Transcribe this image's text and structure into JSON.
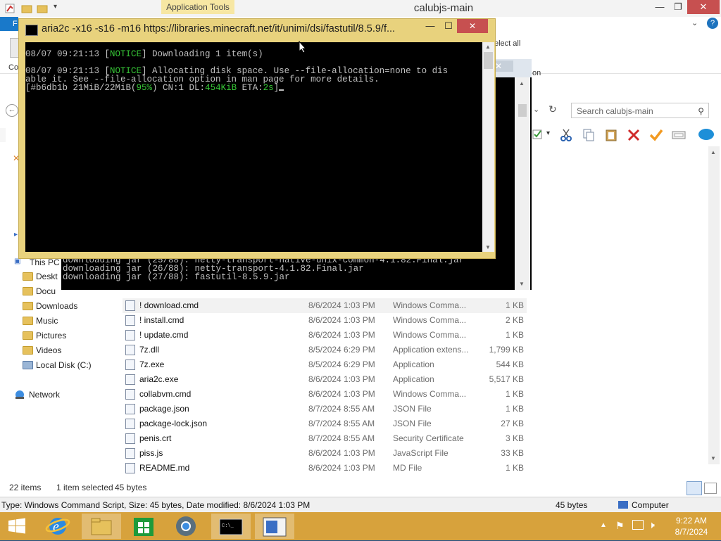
{
  "explorer": {
    "title": "calubjs-main",
    "context_tab": "Application Tools",
    "ribbon": {
      "select_all": "elect all",
      "cut_label": "Co",
      "open_label": "on"
    },
    "search_placeholder": "Search calubjs-main",
    "nav": {
      "this_pc": "This PC",
      "items": [
        {
          "label": "Deskt"
        },
        {
          "label": "Docu"
        },
        {
          "label": "Downloads"
        },
        {
          "label": "Music"
        },
        {
          "label": "Pictures"
        },
        {
          "label": "Videos"
        },
        {
          "label": "Local Disk (C:)"
        }
      ],
      "network": "Network"
    },
    "files": [
      {
        "name": "! download.cmd",
        "date": "8/6/2024 1:03 PM",
        "type": "Windows Comma...",
        "size": "1 KB",
        "selected": true
      },
      {
        "name": "! install.cmd",
        "date": "8/6/2024 1:03 PM",
        "type": "Windows Comma...",
        "size": "2 KB"
      },
      {
        "name": "! update.cmd",
        "date": "8/6/2024 1:03 PM",
        "type": "Windows Comma...",
        "size": "1 KB"
      },
      {
        "name": "7z.dll",
        "date": "8/5/2024 6:29 PM",
        "type": "Application extens...",
        "size": "1,799 KB"
      },
      {
        "name": "7z.exe",
        "date": "8/5/2024 6:29 PM",
        "type": "Application",
        "size": "544 KB"
      },
      {
        "name": "aria2c.exe",
        "date": "8/6/2024 1:03 PM",
        "type": "Application",
        "size": "5,517 KB"
      },
      {
        "name": "collabvm.cmd",
        "date": "8/6/2024 1:03 PM",
        "type": "Windows Comma...",
        "size": "1 KB"
      },
      {
        "name": "package.json",
        "date": "8/7/2024 8:55 AM",
        "type": "JSON File",
        "size": "1 KB"
      },
      {
        "name": "package-lock.json",
        "date": "8/7/2024 8:55 AM",
        "type": "JSON File",
        "size": "27 KB"
      },
      {
        "name": "penis.crt",
        "date": "8/7/2024 8:55 AM",
        "type": "Security Certificate",
        "size": "3 KB"
      },
      {
        "name": "piss.js",
        "date": "8/6/2024 1:03 PM",
        "type": "JavaScript File",
        "size": "33 KB"
      },
      {
        "name": "README.md",
        "date": "8/6/2024 1:03 PM",
        "type": "MD File",
        "size": "1 KB"
      }
    ],
    "status": {
      "items": "22 items",
      "selected": "1 item selected",
      "sel_size": "45 bytes"
    },
    "details": {
      "text": "Type: Windows Command Script, Size: 45 bytes, Date modified: 8/6/2024 1:03 PM",
      "size": "45 bytes",
      "location": "Computer"
    }
  },
  "console2": {
    "lines": [
      "downloading jar (25/88): netty-transport-native-unix-common-4.1.82.Final.jar",
      "downloading jar (26/88): netty-transport-4.1.82.Final.jar",
      "downloading jar (27/88): fastutil-8.5.9.jar"
    ]
  },
  "aria": {
    "title": "aria2c  -x16 -s16 -m16 https://libraries.minecraft.net/it/unimi/dsi/fastutil/8.5.9/f...",
    "line1_time": "08/07 09:21:13 [",
    "line1_tag": "NOTICE",
    "line1_msg": "] Downloading 1 item(s)",
    "line2_time": "08/07 09:21:13 [",
    "line2_tag": "NOTICE",
    "line2_msg": "] Allocating disk space. Use --file-allocation=none to dis",
    "line3": "able it. See --file-allocation option in man page for more details.",
    "progress_a": "[#b6db1b 21MiB/22MiB(",
    "progress_pct": "95%",
    "progress_b": ") CN:1 DL:",
    "progress_dl": "454KiB",
    "progress_c": " ETA:",
    "progress_eta": "2s",
    "progress_d": "]"
  },
  "taskbar": {
    "time": "9:22 AM",
    "date": "8/7/2024"
  },
  "colors": {
    "taskbar": "#d7a23c",
    "aria_frame": "#e8d27d",
    "console_green": "#37c837"
  }
}
